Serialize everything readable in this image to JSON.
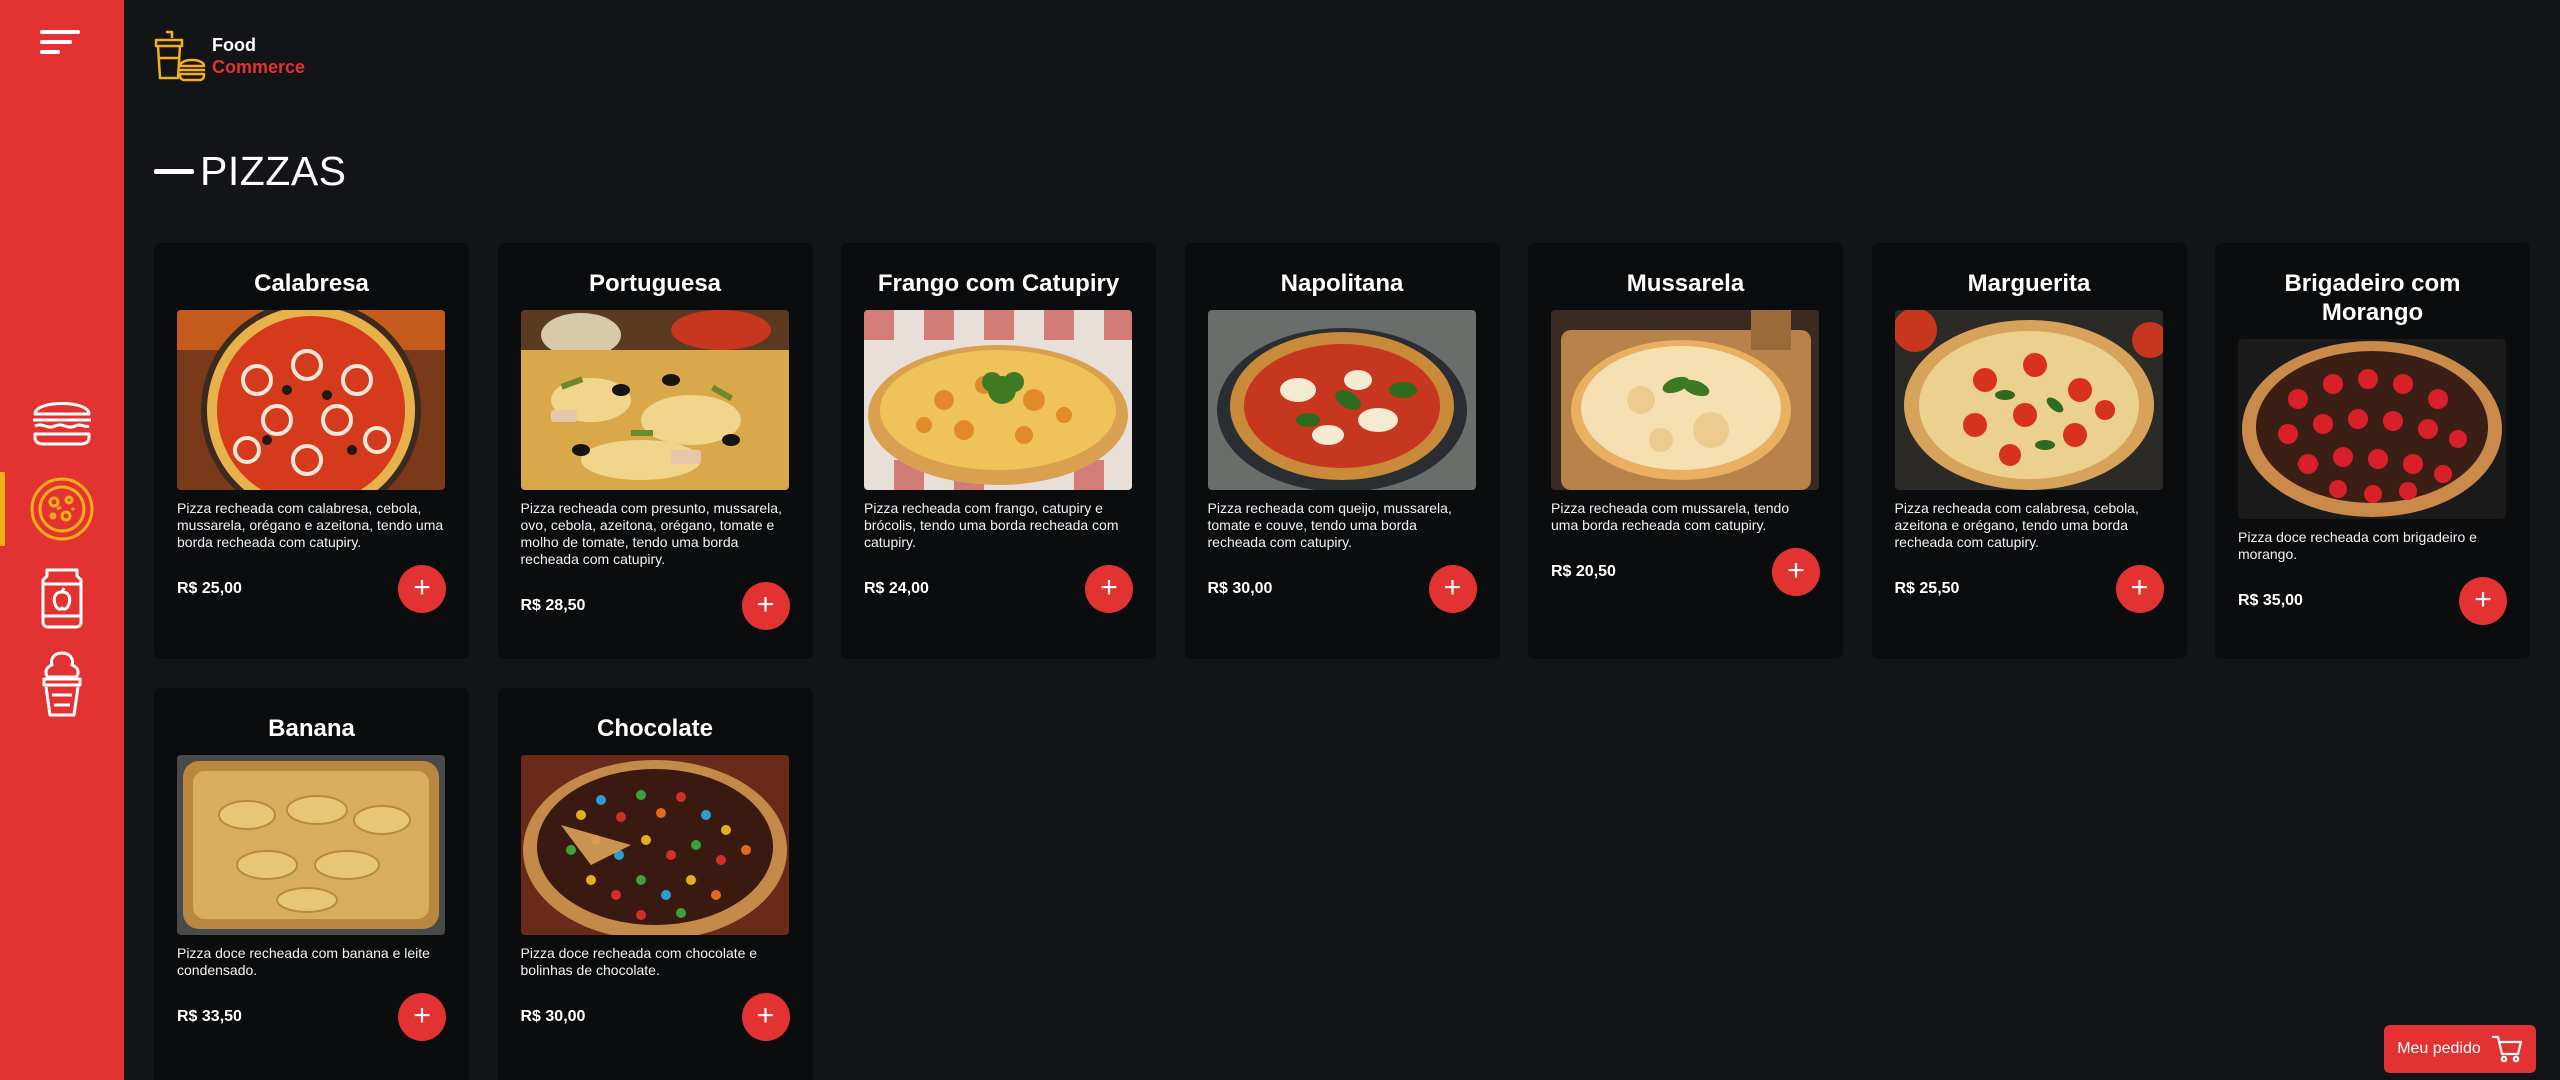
{
  "logo": {
    "line1": "Food",
    "line2": "Commerce",
    "icon": "food-logo-icon"
  },
  "sidebar": {
    "menu_icon": "menu-icon",
    "items": [
      {
        "name": "hamburger",
        "icon": "burger-icon",
        "active": false
      },
      {
        "name": "pizza",
        "icon": "pizza-icon",
        "active": true
      },
      {
        "name": "drinks",
        "icon": "drink-can-icon",
        "active": false
      },
      {
        "name": "ice-cream",
        "icon": "ice-cream-icon",
        "active": false
      }
    ]
  },
  "section": {
    "title": "PIZZAS"
  },
  "products": [
    {
      "name": "Calabresa",
      "description": "Pizza recheada com calabresa, cebola, mussarela, orégano e azeitona, tendo uma borda recheada com catupiry.",
      "price": "R$ 25,00"
    },
    {
      "name": "Portuguesa",
      "description": "Pizza recheada com presunto, mussarela, ovo, cebola, azeitona, orégano, tomate e molho de tomate, tendo uma borda recheada com catupiry.",
      "price": "R$ 28,50"
    },
    {
      "name": "Frango com Catupiry",
      "description": "Pizza recheada com frango, catupiry e brócolis, tendo uma borda recheada com catupiry.",
      "price": "R$ 24,00"
    },
    {
      "name": "Napolitana",
      "description": "Pizza recheada com queijo, mussarela, tomate e couve, tendo uma borda recheada com catupiry.",
      "price": "R$ 30,00"
    },
    {
      "name": "Mussarela",
      "description": "Pizza recheada com mussarela, tendo uma borda recheada com catupiry.",
      "price": "R$ 20,50"
    },
    {
      "name": "Marguerita",
      "description": "Pizza recheada com calabresa, cebola, azeitona e orégano, tendo uma borda recheada com catupiry.",
      "price": "R$ 25,50"
    },
    {
      "name": "Brigadeiro com Morango",
      "description": "Pizza doce recheada com brigadeiro e morango.",
      "price": "R$ 35,00"
    },
    {
      "name": "Banana",
      "description": "Pizza doce recheada com banana e leite condensado.",
      "price": "R$ 33,50"
    },
    {
      "name": "Chocolate",
      "description": "Pizza doce recheada com chocolate e bolinhas de chocolate.",
      "price": "R$ 30,00"
    }
  ],
  "add_icon": "plus-icon",
  "order_button": {
    "label": "Meu pedido",
    "icon": "cart-icon"
  },
  "colors": {
    "accent": "#e33232",
    "background": "#131418",
    "card": "#0b0c0e",
    "highlight": "#f5b019"
  }
}
